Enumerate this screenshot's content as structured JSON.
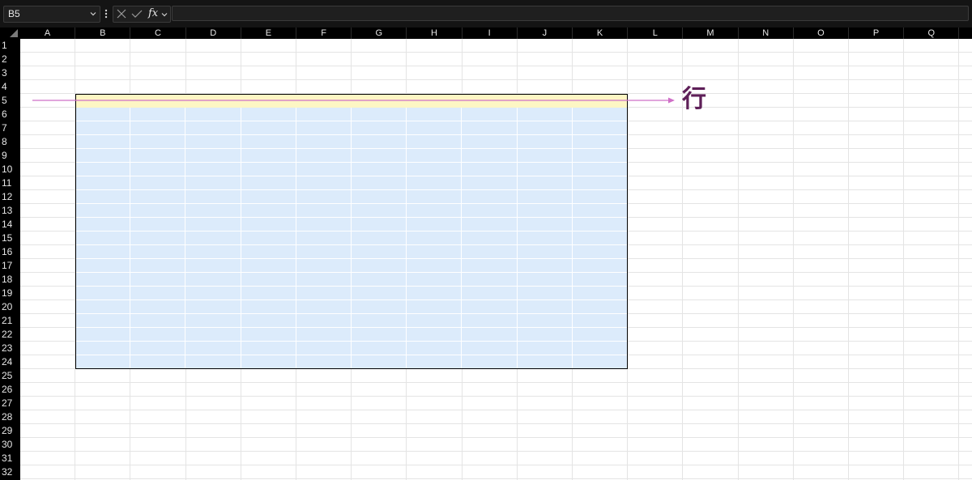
{
  "formula_bar": {
    "name_box": "B5",
    "fx_label": "fx",
    "formula_value": ""
  },
  "columns": [
    "A",
    "B",
    "C",
    "D",
    "E",
    "F",
    "G",
    "H",
    "I",
    "J",
    "K",
    "L",
    "M",
    "N",
    "O",
    "P",
    "Q"
  ],
  "rows": [
    "1",
    "2",
    "3",
    "4",
    "5",
    "6",
    "7",
    "8",
    "9",
    "10",
    "11",
    "12",
    "13",
    "14",
    "15",
    "16",
    "17",
    "18",
    "19",
    "20",
    "21",
    "22",
    "23",
    "24",
    "25",
    "26",
    "27",
    "28",
    "29",
    "30",
    "31",
    "32"
  ],
  "annotation": {
    "label": "行",
    "color": "#5e1f58",
    "arrow_color": "#cf6fc7"
  },
  "table": {
    "header_color": "#fdf6c4",
    "body_color": "#dcebfb"
  },
  "icons": [
    "chevron-down-icon",
    "more-vertical-icon",
    "cancel-icon",
    "confirm-icon",
    "function-icon"
  ]
}
